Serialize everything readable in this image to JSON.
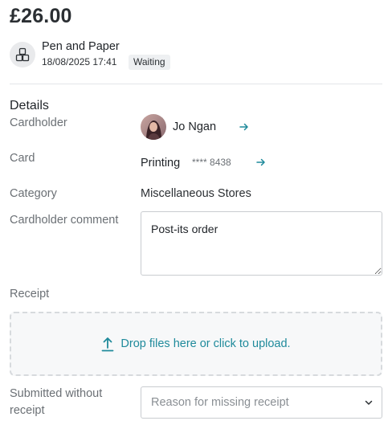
{
  "header": {
    "amount": "£26.00",
    "merchant": "Pen and Paper",
    "date": "18/08/2025 17:41",
    "status": "Waiting"
  },
  "details": {
    "title": "Details",
    "cardholder": {
      "label": "Cardholder",
      "name": "Jo Ngan",
      "icon": "arrow-right-icon"
    },
    "card": {
      "label": "Card",
      "name": "Printing",
      "number": "**** 8438",
      "icon": "arrow-right-icon"
    },
    "category": {
      "label": "Category",
      "value": "Miscellaneous Stores"
    },
    "comment": {
      "label": "Cardholder comment",
      "value": "Post-its order"
    }
  },
  "receipt": {
    "label": "Receipt",
    "upload_text": "Drop files here or click to upload.",
    "icon": "upload-icon"
  },
  "missing_receipt": {
    "label_line1": "Submitted without",
    "label_line2": "receipt",
    "placeholder": "Reason for missing receipt",
    "icon": "chevron-down-icon"
  },
  "colors": {
    "accent": "#1f8a9b",
    "muted_text": "#6b7075",
    "badge_bg": "#eef0f2"
  }
}
